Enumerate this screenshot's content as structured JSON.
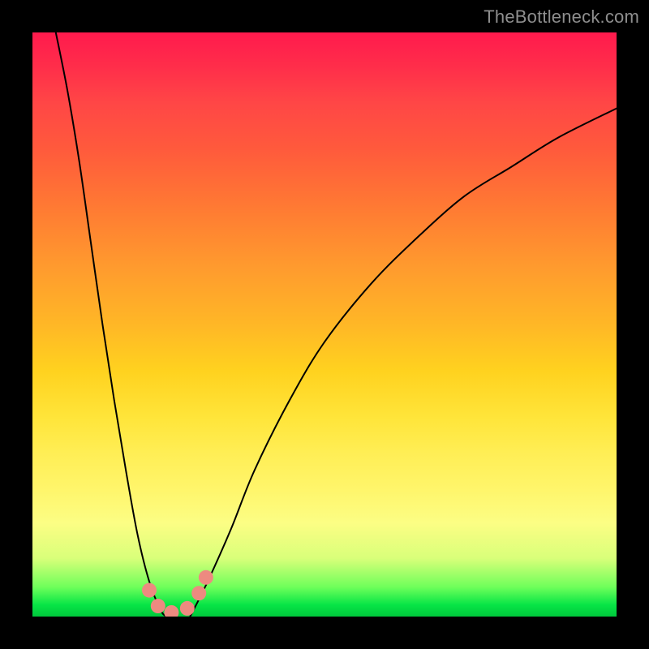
{
  "watermark": "TheBottleneck.com",
  "chart_data": {
    "type": "line",
    "title": "",
    "xlabel": "",
    "ylabel": "",
    "xlim": [
      0,
      100
    ],
    "ylim": [
      0,
      100
    ],
    "grid": false,
    "legend": false,
    "background_gradient": {
      "top": "#ff1a4d",
      "middle": "#ffe53a",
      "bottom": "#00c83c"
    },
    "series": [
      {
        "name": "left-curve",
        "x": [
          4,
          6,
          8,
          10,
          12,
          14,
          16,
          18,
          20,
          22,
          23
        ],
        "y": [
          100,
          90,
          78,
          64,
          50,
          37,
          25,
          14,
          6,
          1,
          0
        ]
      },
      {
        "name": "right-curve",
        "x": [
          27,
          30,
          34,
          38,
          44,
          50,
          58,
          66,
          74,
          82,
          90,
          100
        ],
        "y": [
          0,
          6,
          15,
          25,
          37,
          47,
          57,
          65,
          72,
          77,
          82,
          87
        ]
      }
    ],
    "markers": [
      {
        "x": 20.0,
        "y": 4.5
      },
      {
        "x": 21.5,
        "y": 1.8
      },
      {
        "x": 23.8,
        "y": 0.7
      },
      {
        "x": 26.5,
        "y": 1.4
      },
      {
        "x": 28.5,
        "y": 4.0
      },
      {
        "x": 29.7,
        "y": 6.7
      }
    ],
    "marker_color": "#ed8a80",
    "marker_radius_px": 9
  }
}
